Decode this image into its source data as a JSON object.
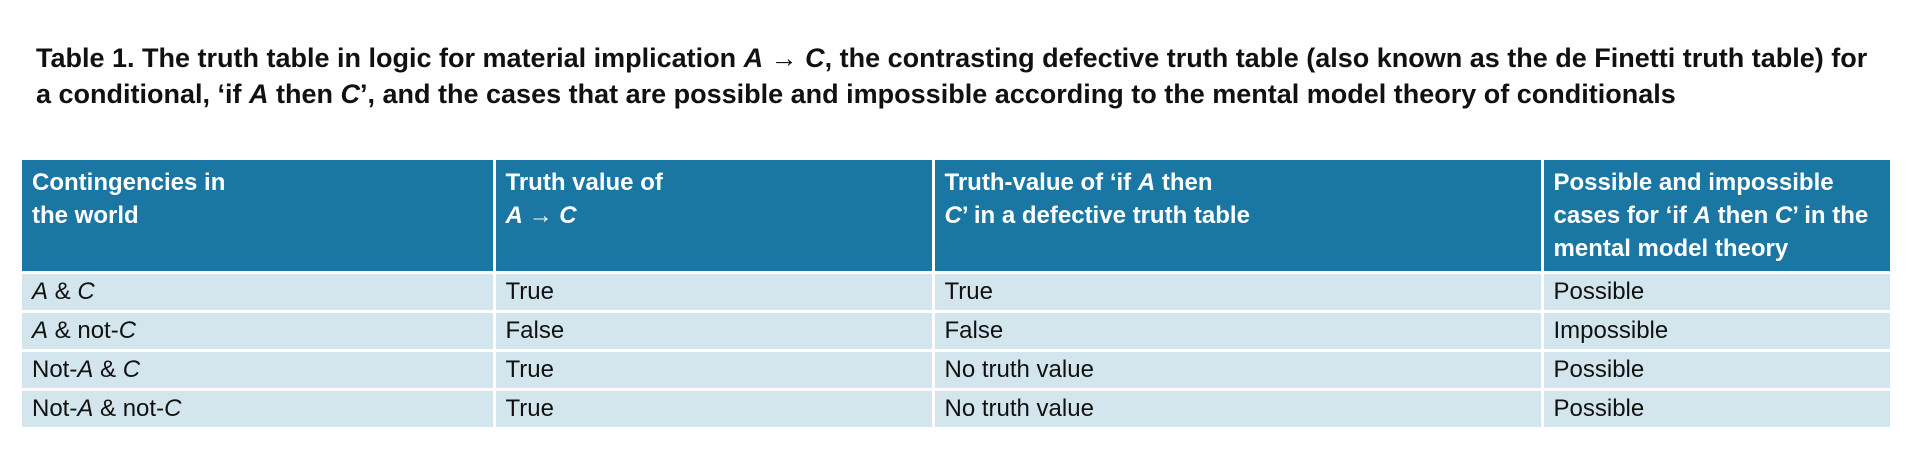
{
  "caption": {
    "label": "Table 1.",
    "parts": [
      " The truth table in logic for material implication ",
      "A",
      " → ",
      "C",
      ", the contrasting defective truth table (also known as the de Finetti truth table) for a conditional, ‘if ",
      "A",
      " then ",
      "C",
      "’, and the cases that are possible and impossible according to the mental model theory of conditionals"
    ]
  },
  "headers": [
    {
      "parts": [
        "Contingencies in",
        "the world"
      ]
    },
    {
      "parts": [
        "Truth value of",
        "A → C"
      ]
    },
    {
      "parts": [
        "Truth-value of ‘if ",
        "A",
        " then",
        "C",
        "’ in a defective truth table"
      ]
    },
    {
      "parts": [
        "Possible and impossible cases for ‘if ",
        "A",
        " then ",
        "C",
        "’ in the mental model theory"
      ]
    }
  ],
  "rows": [
    {
      "contingency": {
        "a_prefix": "",
        "a": "A",
        "mid": " & ",
        "c_prefix": "",
        "c": "C"
      },
      "material": "True",
      "defective": "True",
      "model": "Possible"
    },
    {
      "contingency": {
        "a_prefix": "",
        "a": "A",
        "mid": " & ",
        "c_prefix": "not-",
        "c": "C"
      },
      "material": "False",
      "defective": "False",
      "model": "Impossible"
    },
    {
      "contingency": {
        "a_prefix": "Not-",
        "a": "A",
        "mid": " & ",
        "c_prefix": "",
        "c": "C"
      },
      "material": "True",
      "defective": "No truth value",
      "model": "Possible"
    },
    {
      "contingency": {
        "a_prefix": "Not-",
        "a": "A",
        "mid": " & ",
        "c_prefix": "not-",
        "c": "C"
      },
      "material": "True",
      "defective": "No truth value",
      "model": "Possible"
    }
  ],
  "colors": {
    "header_bg": "#1a76a2",
    "row_bg": "#d3e6ee",
    "text": "#111111"
  }
}
